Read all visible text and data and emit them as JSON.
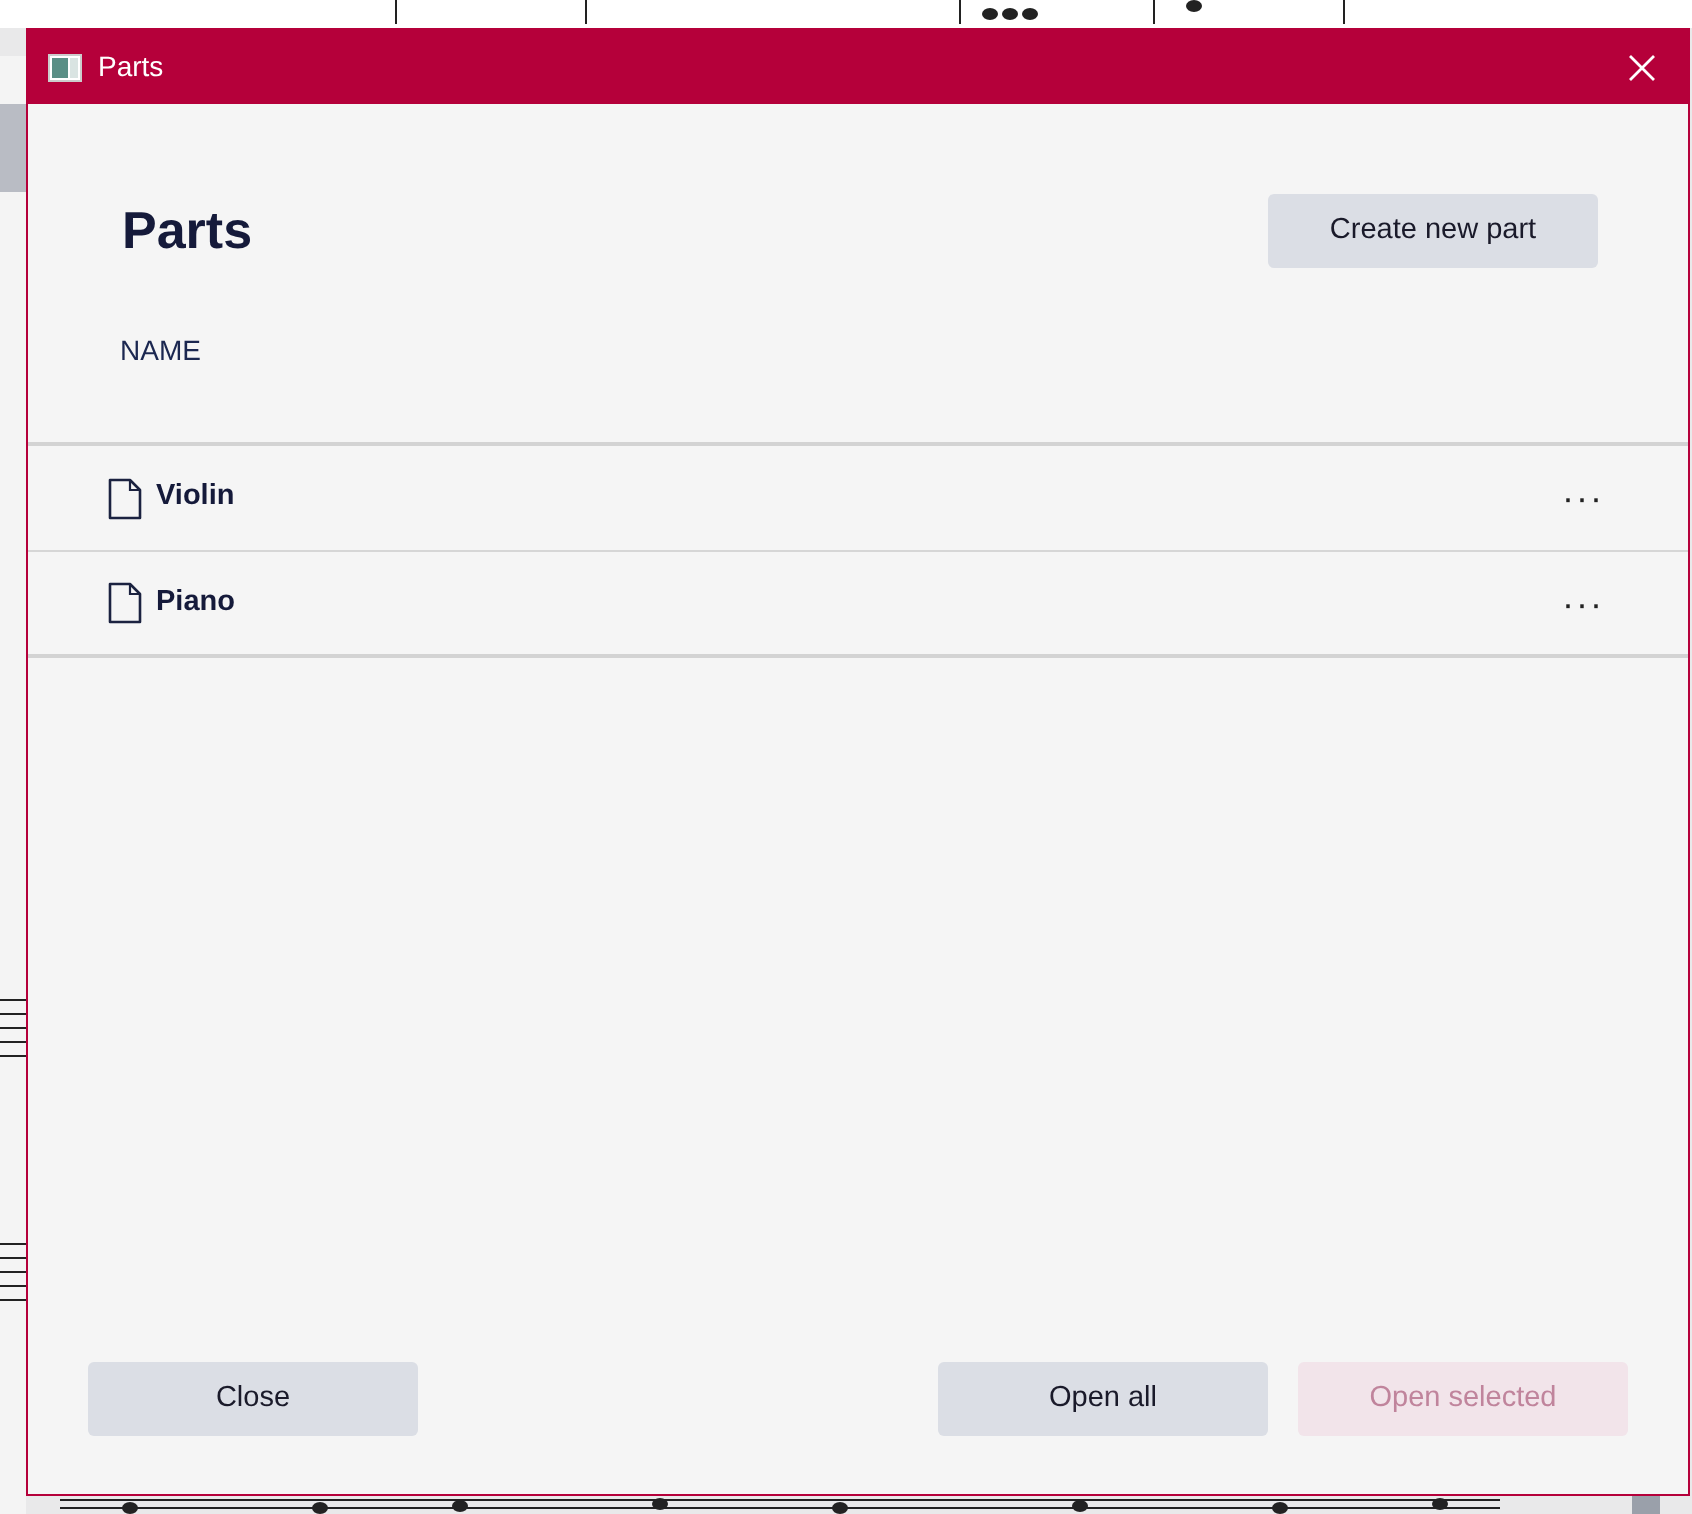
{
  "window": {
    "title": "Parts"
  },
  "heading": "Parts",
  "create_button": "Create new part",
  "columns": [
    "NAME"
  ],
  "parts": [
    {
      "name": "Violin",
      "selected": false
    },
    {
      "name": "Piano",
      "selected": false
    }
  ],
  "more_glyph": "···",
  "buttons": [
    {
      "label": "Close",
      "disabled": false
    },
    {
      "label": "Open all",
      "disabled": false
    },
    {
      "label": "Open selected",
      "disabled": true
    }
  ]
}
